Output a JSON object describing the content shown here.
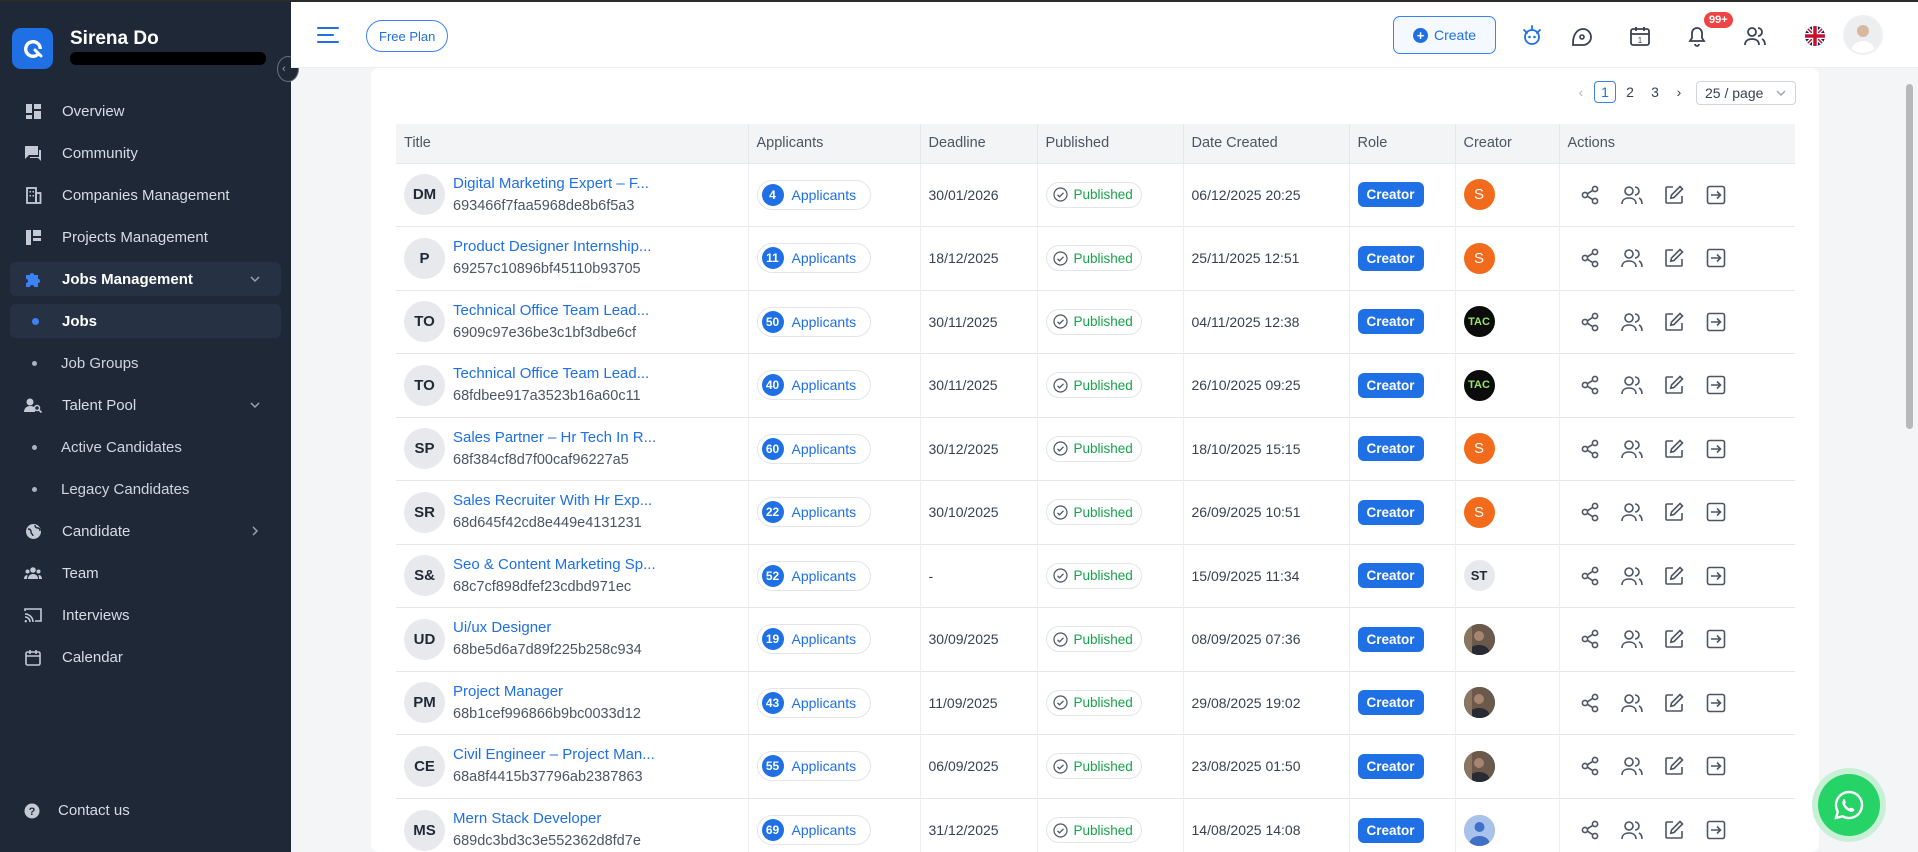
{
  "brand": {
    "name": "Sirena Do"
  },
  "sidebar": {
    "items": [
      {
        "label": "Overview",
        "icon": "dashboard-icon"
      },
      {
        "label": "Community",
        "icon": "chat-icon"
      },
      {
        "label": "Companies Management",
        "icon": "building-icon"
      },
      {
        "label": "Projects Management",
        "icon": "projects-icon"
      },
      {
        "label": "Jobs Management",
        "icon": "puzzle-icon",
        "expanded": true
      },
      {
        "label": "Jobs",
        "sub": true,
        "active": true
      },
      {
        "label": "Job Groups",
        "sub": true
      },
      {
        "label": "Talent Pool",
        "icon": "talent-icon",
        "expanded": true
      },
      {
        "label": "Active Candidates",
        "sub": true
      },
      {
        "label": "Legacy Candidates",
        "sub": true
      },
      {
        "label": "Candidate",
        "icon": "globe-icon"
      },
      {
        "label": "Team",
        "icon": "team-icon"
      },
      {
        "label": "Interviews",
        "icon": "cast-icon"
      },
      {
        "label": "Calendar",
        "icon": "calendar-icon"
      }
    ],
    "contact": "Contact us"
  },
  "header": {
    "plan": "Free Plan",
    "create": "Create",
    "notifications_badge": "99+"
  },
  "pagination": {
    "pages": [
      "1",
      "2",
      "3"
    ],
    "current": "1",
    "page_size": "25 / page"
  },
  "table": {
    "columns": [
      "Title",
      "Applicants",
      "Deadline",
      "Published",
      "Date Created",
      "Role",
      "Creator",
      "Actions"
    ],
    "applicants_label": "Applicants",
    "published_label": "Published",
    "role_label": "Creator",
    "rows": [
      {
        "initials": "DM",
        "title": "Digital Marketing Expert – F...",
        "id": "693466f7faa5968de8b6f5a3",
        "applicants": "4",
        "deadline": "30/01/2026",
        "created": "06/12/2025 20:25",
        "creator": "S",
        "creator_style": "s"
      },
      {
        "initials": "P",
        "title": "Product Designer Internship...",
        "id": "69257c10896bf45110b93705",
        "applicants": "11",
        "deadline": "18/12/2025",
        "created": "25/11/2025 12:51",
        "creator": "S",
        "creator_style": "s"
      },
      {
        "initials": "TO",
        "title": "Technical Office Team Lead...",
        "id": "6909c97e36be3c1bf3dbe6cf",
        "applicants": "50",
        "deadline": "30/11/2025",
        "created": "04/11/2025 12:38",
        "creator": "TAC",
        "creator_style": "tac"
      },
      {
        "initials": "TO",
        "title": "Technical Office Team Lead...",
        "id": "68fdbee917a3523b16a60c11",
        "applicants": "40",
        "deadline": "30/11/2025",
        "created": "26/10/2025 09:25",
        "creator": "TAC",
        "creator_style": "tac"
      },
      {
        "initials": "SP",
        "title": "Sales Partner – Hr Tech In R...",
        "id": "68f384cf8d7f00caf96227a5",
        "applicants": "60",
        "deadline": "30/12/2025",
        "created": "18/10/2025 15:15",
        "creator": "S",
        "creator_style": "s"
      },
      {
        "initials": "SR",
        "title": "Sales Recruiter With Hr Exp...",
        "id": "68d645f42cd8e449e4131231",
        "applicants": "22",
        "deadline": "30/10/2025",
        "created": "26/09/2025 10:51",
        "creator": "S",
        "creator_style": "s"
      },
      {
        "initials": "S&",
        "title": "Seo & Content Marketing Sp...",
        "id": "68c7cf898dfef23cdbd971ec",
        "applicants": "52",
        "deadline": "-",
        "created": "15/09/2025 11:34",
        "creator": "ST",
        "creator_style": "st"
      },
      {
        "initials": "UD",
        "title": "Ui/ux Designer",
        "id": "68be5d6a7d89f225b258c934",
        "applicants": "19",
        "deadline": "30/09/2025",
        "created": "08/09/2025 07:36",
        "creator": "",
        "creator_style": "photo"
      },
      {
        "initials": "PM",
        "title": "Project Manager",
        "id": "68b1cef996866b9bc0033d12",
        "applicants": "43",
        "deadline": "11/09/2025",
        "created": "29/08/2025 19:02",
        "creator": "",
        "creator_style": "photo"
      },
      {
        "initials": "CE",
        "title": "Civil Engineer – Project Man...",
        "id": "68a8f4415b37796ab2387863",
        "applicants": "55",
        "deadline": "06/09/2025",
        "created": "23/08/2025 01:50",
        "creator": "",
        "creator_style": "photo"
      },
      {
        "initials": "MS",
        "title": "Mern Stack Developer",
        "id": "689dc3bd3c3e552362d8fd7e",
        "applicants": "69",
        "deadline": "31/12/2025",
        "created": "14/08/2025 14:08",
        "creator": "",
        "creator_style": "default"
      }
    ]
  }
}
